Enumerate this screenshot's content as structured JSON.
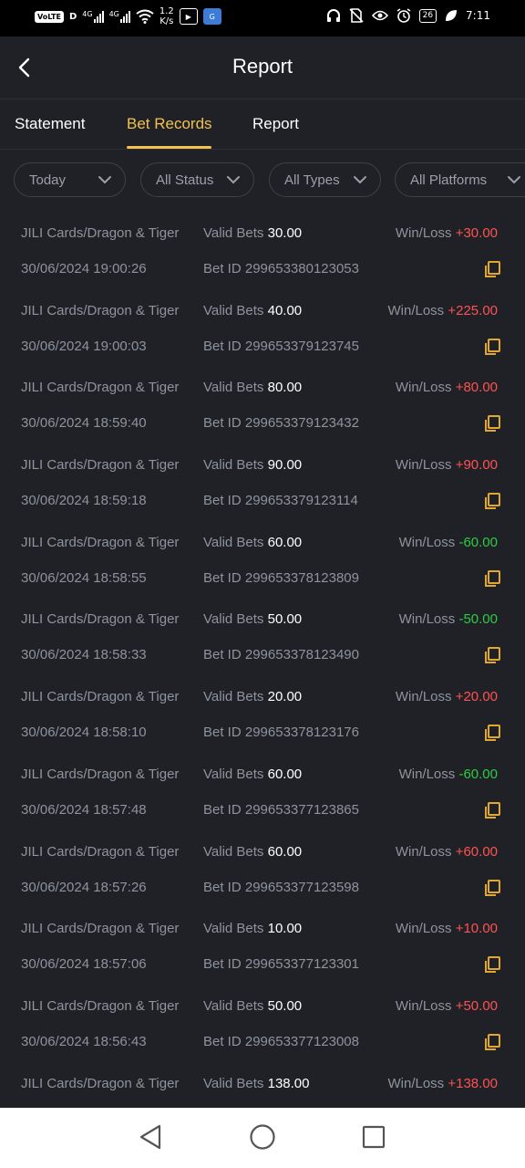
{
  "status_bar": {
    "volte": "VoLTE",
    "sim_label": "D",
    "net1": "4G",
    "net2": "4G",
    "speed_value": "1.2",
    "speed_unit": "K/s",
    "battery": "26",
    "time": "7:11",
    "icons": [
      "headphones-icon",
      "no-sim-icon",
      "eye-icon",
      "alarm-icon",
      "leaf-icon"
    ]
  },
  "header": {
    "title": "Report",
    "back_icon": "chevron-left-icon"
  },
  "tabs": [
    {
      "label": "Statement",
      "active": false
    },
    {
      "label": "Bet Records",
      "active": true
    },
    {
      "label": "Report",
      "active": false
    }
  ],
  "filters": [
    "Today",
    "All Status",
    "All Types",
    "All Platforms"
  ],
  "records": {
    "valid_bets_label": "Valid Bets",
    "win_loss_label": "Win/Loss",
    "bet_id_label": "Bet ID",
    "items": [
      {
        "game": "JILI Cards/Dragon & Tiger",
        "valid_bets": "30.00",
        "win_loss": "+30.00",
        "time": "30/06/2024 19:00:26",
        "bet_id": "299653380123053"
      },
      {
        "game": "JILI Cards/Dragon & Tiger",
        "valid_bets": "40.00",
        "win_loss": "+225.00",
        "time": "30/06/2024 19:00:03",
        "bet_id": "299653379123745"
      },
      {
        "game": "JILI Cards/Dragon & Tiger",
        "valid_bets": "80.00",
        "win_loss": "+80.00",
        "time": "30/06/2024 18:59:40",
        "bet_id": "299653379123432"
      },
      {
        "game": "JILI Cards/Dragon & Tiger",
        "valid_bets": "90.00",
        "win_loss": "+90.00",
        "time": "30/06/2024 18:59:18",
        "bet_id": "299653379123114"
      },
      {
        "game": "JILI Cards/Dragon & Tiger",
        "valid_bets": "60.00",
        "win_loss": "-60.00",
        "time": "30/06/2024 18:58:55",
        "bet_id": "299653378123809"
      },
      {
        "game": "JILI Cards/Dragon & Tiger",
        "valid_bets": "50.00",
        "win_loss": "-50.00",
        "time": "30/06/2024 18:58:33",
        "bet_id": "299653378123490"
      },
      {
        "game": "JILI Cards/Dragon & Tiger",
        "valid_bets": "20.00",
        "win_loss": "+20.00",
        "time": "30/06/2024 18:58:10",
        "bet_id": "299653378123176"
      },
      {
        "game": "JILI Cards/Dragon & Tiger",
        "valid_bets": "60.00",
        "win_loss": "-60.00",
        "time": "30/06/2024 18:57:48",
        "bet_id": "299653377123865"
      },
      {
        "game": "JILI Cards/Dragon & Tiger",
        "valid_bets": "60.00",
        "win_loss": "+60.00",
        "time": "30/06/2024 18:57:26",
        "bet_id": "299653377123598"
      },
      {
        "game": "JILI Cards/Dragon & Tiger",
        "valid_bets": "10.00",
        "win_loss": "+10.00",
        "time": "30/06/2024 18:57:06",
        "bet_id": "299653377123301"
      },
      {
        "game": "JILI Cards/Dragon & Tiger",
        "valid_bets": "50.00",
        "win_loss": "+50.00",
        "time": "30/06/2024 18:56:43",
        "bet_id": "299653377123008"
      },
      {
        "game": "JILI Cards/Dragon & Tiger",
        "valid_bets": "138.00",
        "win_loss": "+138.00",
        "time": "",
        "bet_id": ""
      }
    ]
  },
  "colors": {
    "background": "#1f2127",
    "accent": "#f2c14e",
    "win": "#ff5252",
    "loss": "#2ecc40",
    "muted_text": "#8e939d"
  },
  "nav_bar": {
    "icons": [
      "back-triangle-icon",
      "home-circle-icon",
      "recents-square-icon"
    ]
  }
}
